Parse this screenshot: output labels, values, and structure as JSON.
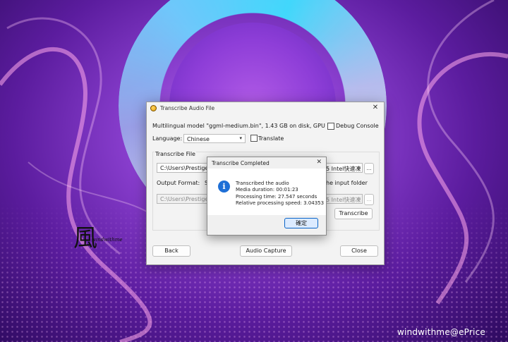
{
  "wallpaper": {
    "logo_char": "風",
    "logo_sub": "windwithme",
    "watermark": "windwithme@ePrice"
  },
  "window": {
    "title": "Transcribe Audio File",
    "close_glyph": "✕",
    "model_info": "Multilingual model \"ggml-medium.bin\", 1.43 GB on disk, GPU",
    "debug_console_label": "Debug Console",
    "language_label": "Language:",
    "language_value": "Chinese",
    "translate_label": "Translate",
    "transcribe_file_label": "Transcribe File",
    "file_path": "C:\\Users\\Prestige 16",
    "file_path_right": "5 Intel快速凍",
    "browse_label": "...",
    "output_format_label": "Output Format:",
    "output_format_value_partial": "Sr",
    "input_folder_partial": "he input folder",
    "output_path": "C:\\Users\\Prestige 16",
    "output_path_right": "5 Intel快速凍",
    "transcribe_button": "Transcribe",
    "back_button": "Back",
    "audio_capture_button": "Audio Capture",
    "close_button": "Close"
  },
  "dialog": {
    "title": "Transcribe Completed",
    "close_glyph": "✕",
    "icon": "info-icon",
    "lines": [
      "Transcribed the audio",
      "Media duration: 00:01:23",
      "Processing time: 27.547 seconds",
      "Relative processing speed: 3.04353"
    ],
    "ok_button": "確定"
  }
}
